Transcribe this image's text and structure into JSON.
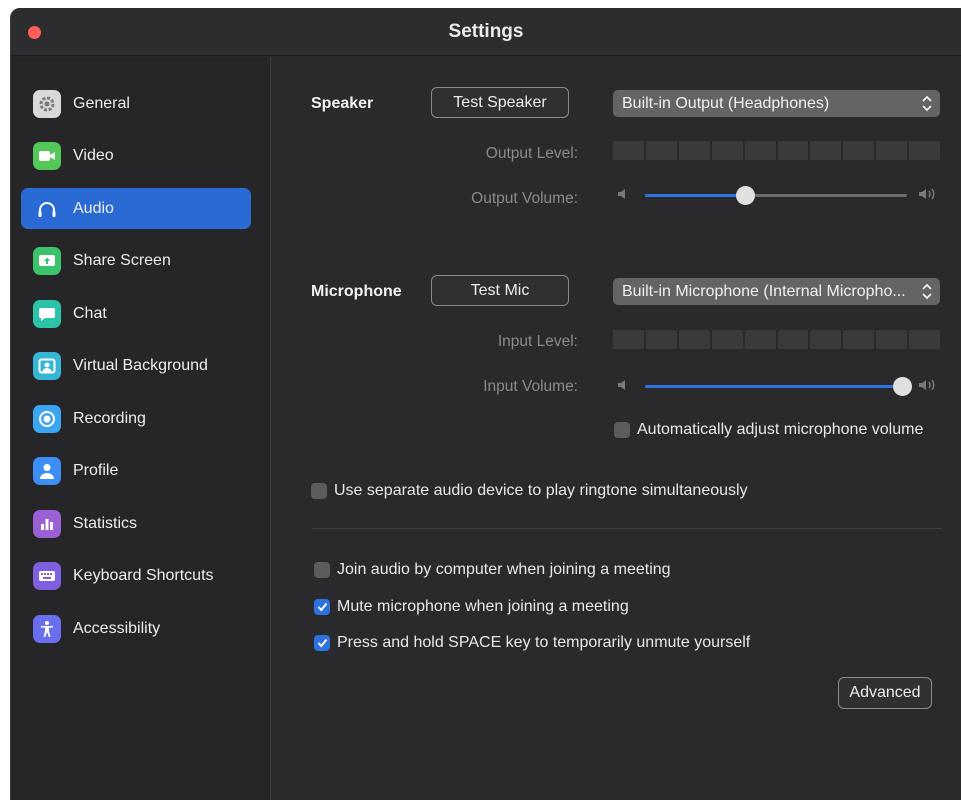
{
  "window": {
    "title": "Settings"
  },
  "sidebar": {
    "items": [
      {
        "label": "General",
        "icon": "gear-icon",
        "color": "#d9d9d9",
        "active": false
      },
      {
        "label": "Video",
        "icon": "video-camera-icon",
        "color": "#54c95a",
        "active": false
      },
      {
        "label": "Audio",
        "icon": "headphones-icon",
        "color": "#2a6ad5",
        "active": true
      },
      {
        "label": "Share Screen",
        "icon": "share-screen-icon",
        "color": "#3cc26b",
        "active": false
      },
      {
        "label": "Chat",
        "icon": "chat-bubble-icon",
        "color": "#2cc3a8",
        "active": false
      },
      {
        "label": "Virtual Background",
        "icon": "virtual-background-icon",
        "color": "#35b6d6",
        "active": false
      },
      {
        "label": "Recording",
        "icon": "recording-icon",
        "color": "#3aa6f2",
        "active": false
      },
      {
        "label": "Profile",
        "icon": "profile-icon",
        "color": "#3d8ef5",
        "active": false
      },
      {
        "label": "Statistics",
        "icon": "statistics-icon",
        "color": "#9b5fd6",
        "active": false
      },
      {
        "label": "Keyboard Shortcuts",
        "icon": "keyboard-icon",
        "color": "#7f61e0",
        "active": false
      },
      {
        "label": "Accessibility",
        "icon": "accessibility-icon",
        "color": "#6a6ff0",
        "active": false
      }
    ]
  },
  "speaker": {
    "label": "Speaker",
    "test_button": "Test Speaker",
    "device": "Built-in Output (Headphones)",
    "output_level_label": "Output Level:",
    "output_volume_label": "Output Volume:",
    "volume_fraction": 0.38
  },
  "microphone": {
    "label": "Microphone",
    "test_button": "Test Mic",
    "device": "Built-in Microphone (Internal Micropho...",
    "input_level_label": "Input Level:",
    "input_volume_label": "Input Volume:",
    "volume_fraction": 0.98,
    "auto_adjust_label": "Automatically adjust microphone volume",
    "auto_adjust_checked": false
  },
  "options": {
    "separate_device_label": "Use separate audio device to play ringtone simultaneously",
    "separate_device_checked": false,
    "join_audio_label": "Join audio by computer when joining a meeting",
    "join_audio_checked": false,
    "mute_mic_label": "Mute microphone when joining a meeting",
    "mute_mic_checked": true,
    "space_unmute_label": "Press and hold SPACE key to temporarily unmute yourself",
    "space_unmute_checked": true
  },
  "advanced_button": "Advanced",
  "colors": {
    "accent": "#2a6ad5",
    "close": "#ff5f57"
  }
}
